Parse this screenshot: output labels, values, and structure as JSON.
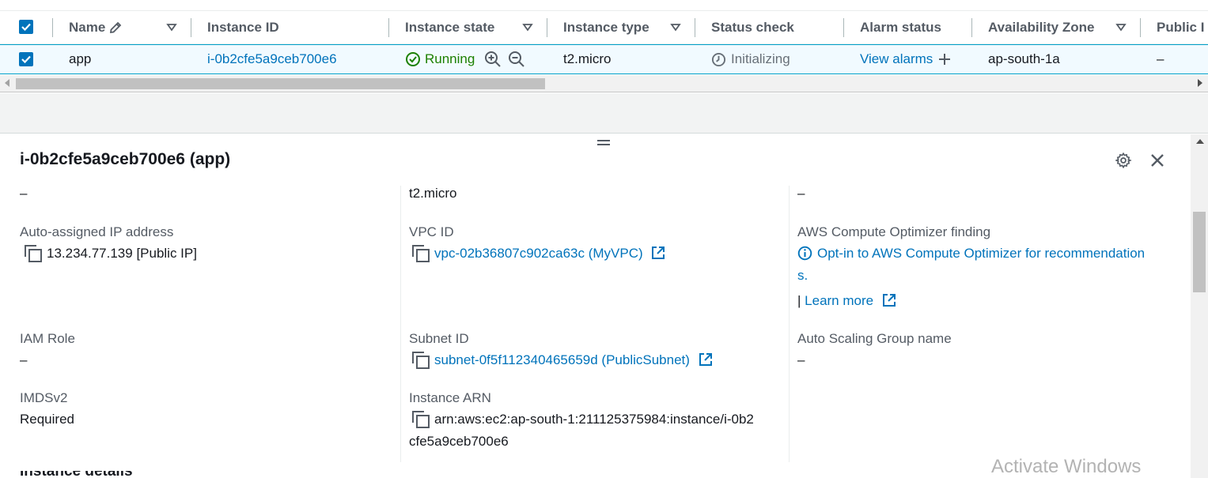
{
  "table": {
    "headers": {
      "name": "Name",
      "instance_id": "Instance ID",
      "instance_state": "Instance state",
      "instance_type": "Instance type",
      "status_check": "Status check",
      "alarm_status": "Alarm status",
      "availability_zone": "Availability Zone",
      "public_ip": "Public I"
    },
    "row": {
      "name": "app",
      "instance_id": "i-0b2cfe5a9ceb700e6",
      "instance_state": "Running",
      "instance_type": "t2.micro",
      "status_check": "Initializing",
      "alarm_status": "View alarms",
      "availability_zone": "ap-south-1a",
      "public_ip": "–"
    }
  },
  "details": {
    "title": "i-0b2cfe5a9ceb700e6 (app)",
    "col1": {
      "top_value": "–",
      "auto_ip_label": "Auto-assigned IP address",
      "auto_ip_value": "13.234.77.139 [Public IP]",
      "iam_label": "IAM Role",
      "iam_value": "–",
      "imds_label": "IMDSv2",
      "imds_value": "Required"
    },
    "col2": {
      "top_value": "t2.micro",
      "vpc_label": "VPC ID",
      "vpc_value": "vpc-02b36807c902ca63c (MyVPC)",
      "subnet_label": "Subnet ID",
      "subnet_value": "subnet-0f5f112340465659d (PublicSubnet)",
      "arn_label": "Instance ARN",
      "arn_line1": "arn:aws:ec2:ap-south-1:211125375984:instance/i-0b2",
      "arn_line2": "cfe5a9ceb700e6"
    },
    "col3": {
      "top_value": "–",
      "optimizer_label": "AWS Compute Optimizer finding",
      "optimizer_link_line1": "Opt-in to AWS Compute Optimizer for recommendation",
      "optimizer_link_line2": "s.",
      "learn_more": "Learn more",
      "asg_label": "Auto Scaling Group name",
      "asg_value": "–"
    },
    "section_cutoff": "Instance details"
  },
  "watermark": "Activate Windows",
  "colors": {
    "link": "#0073bb",
    "success": "#1d8102",
    "selected_row": "#f1faff",
    "border_selected": "#00a1c9"
  }
}
